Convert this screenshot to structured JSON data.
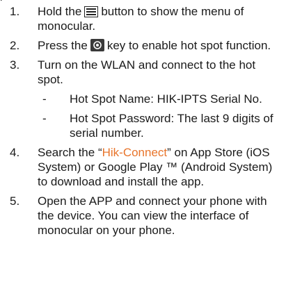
{
  "steps": [
    {
      "number": "1.",
      "before_icon": "Hold the",
      "icon": "menu-icon",
      "after_icon": "button to show the menu of monocular."
    },
    {
      "number": "2.",
      "before_icon": "Press the",
      "icon": "hotspot-key-icon",
      "after_icon": "key to enable hot spot function."
    },
    {
      "number": "3.",
      "text": "Turn on the WLAN and connect to the hot spot.",
      "subitems": [
        {
          "dash": "-",
          "text": "Hot Spot Name: HIK-IPTS Serial No."
        },
        {
          "dash": "-",
          "text": "Hot Spot Password: The last 9 digits of serial number."
        }
      ]
    },
    {
      "number": "4.",
      "before_link": "Search the “",
      "link": "Hik-Connect",
      "after_link": "” on App Store (iOS System) or Google Play ™ (Android System) to download and install the app."
    },
    {
      "number": "5.",
      "text": "Open the APP and connect your phone with the device. You can view the interface of monocular on your phone."
    }
  ],
  "colors": {
    "text": "#1a1a1a",
    "link": "#e8742a"
  }
}
